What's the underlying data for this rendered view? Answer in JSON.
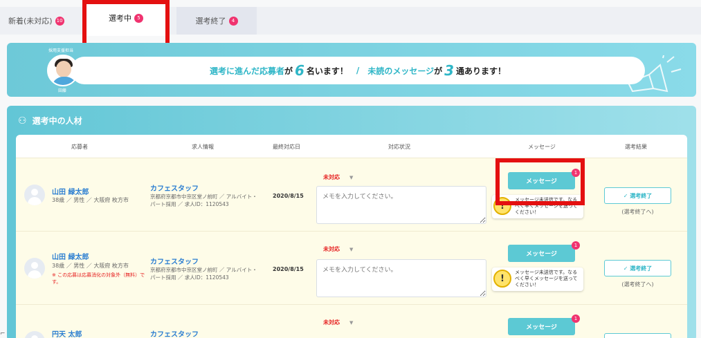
{
  "tabs": [
    {
      "label": "新着(未対応)",
      "badge": "10"
    },
    {
      "label": "選考中",
      "badge": "5"
    },
    {
      "label": "選考終了",
      "badge": "4"
    }
  ],
  "banner": {
    "role_label": "採用支援担当",
    "assignee_name": "田藤",
    "msg_part1": "選考に進んだ応募者",
    "msg_ga1": "が",
    "count_applicants": "6",
    "msg_part2": "名います！",
    "separator": "/",
    "msg_part3": "未読のメッセージ",
    "msg_ga2": "が",
    "count_messages": "3",
    "msg_part4": "通あります！"
  },
  "section": {
    "title": "選考中の人材"
  },
  "table_headers": {
    "applicant": "応募者",
    "job": "求人情報",
    "last_date": "最終対応日",
    "status": "対応状況",
    "message": "メッセージ",
    "result": "選考結果"
  },
  "rows": [
    {
      "name": "山田 緑太郎",
      "meta": "38歳 ／ 男性 ／ 大阪府 枚方市",
      "note": "",
      "job_title": "カフェスタッフ",
      "job_meta": "京都府京都市中京区堂ノ前町 ／ アルバイト・パート採用 ／ 求人ID：1120543",
      "date": "2020/8/15",
      "status": "未対応",
      "memo_placeholder": "メモを入力してください。",
      "msg_button": "メッセージ",
      "msg_badge": "1",
      "warn_text": "メッセージ未送信です。なるべく早くメッセージを送ってください！",
      "end_button": "✓ 選考終了",
      "end_sub": "(選考終了へ)"
    },
    {
      "name": "山田 緑太郎",
      "meta": "38歳 ／ 男性 ／ 大阪府 枚方市",
      "note": "※ この応募は応募消化の対象外（無料）です。",
      "job_title": "カフェスタッフ",
      "job_meta": "京都府京都市中京区堂ノ前町 ／ アルバイト・パート採用 ／ 求人ID：1120543",
      "date": "2020/8/15",
      "status": "未対応",
      "memo_placeholder": "メモを入力してください。",
      "msg_button": "メッセージ",
      "msg_badge": "1",
      "warn_text": "メッセージ未送信です。なるべく早くメッセージを送ってください！",
      "end_button": "✓ 選考終了",
      "end_sub": "(選考終了へ)"
    },
    {
      "name": "円天 太郎",
      "job_title": "カフェスタッフ",
      "status": "未対応",
      "msg_button": "メッセージ",
      "msg_badge": "1"
    }
  ],
  "colors": {
    "accent": "#5cc9d4",
    "badge": "#f0336f",
    "highlight_box": "#e41010",
    "name_link": "#2a7dd1"
  }
}
